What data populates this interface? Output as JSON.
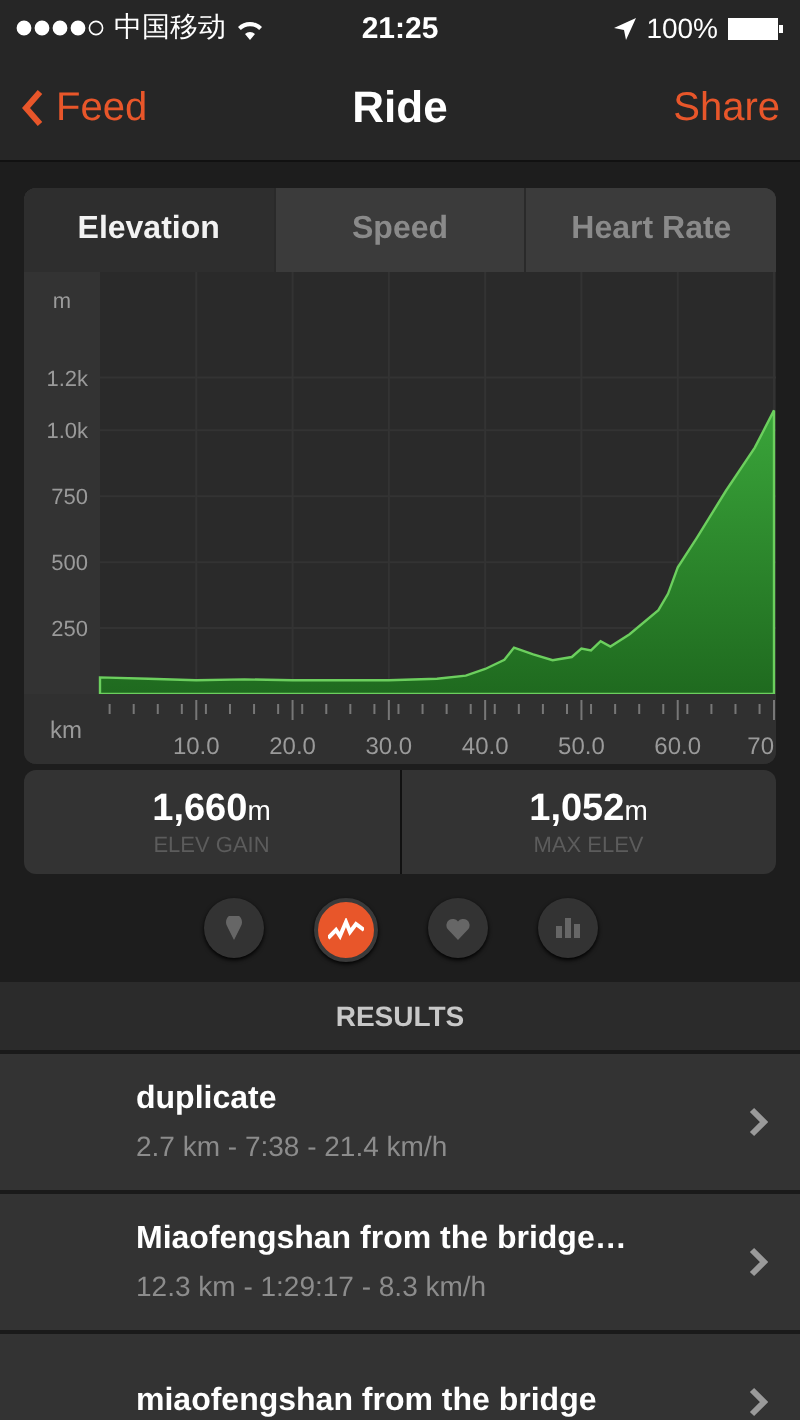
{
  "status_bar": {
    "carrier": "中国移动",
    "time": "21:25",
    "battery": "100%"
  },
  "nav": {
    "back": "Feed",
    "title": "Ride",
    "action": "Share"
  },
  "tabs": [
    {
      "label": "Elevation",
      "selected": true
    },
    {
      "label": "Speed",
      "selected": false
    },
    {
      "label": "Heart Rate",
      "selected": false
    }
  ],
  "chart_data": {
    "type": "area",
    "xlabel": "km",
    "ylabel": "m",
    "xlim": [
      0,
      70
    ],
    "ylim": [
      0,
      1600
    ],
    "grid": true,
    "xticks": [
      {
        "value": 10,
        "label": "10.0"
      },
      {
        "value": 20,
        "label": "20.0"
      },
      {
        "value": 30,
        "label": "30.0"
      },
      {
        "value": 40,
        "label": "40.0"
      },
      {
        "value": 50,
        "label": "50.0"
      },
      {
        "value": 60,
        "label": "60.0"
      },
      {
        "value": 70,
        "label": "70"
      }
    ],
    "yticks": [
      250,
      500,
      750,
      {
        "value": 1000,
        "label": "1.0k"
      },
      {
        "value": 1200,
        "label": "1.2k"
      }
    ],
    "x": [
      0,
      5,
      10,
      15,
      20,
      25,
      30,
      35,
      38,
      40,
      42,
      43,
      45,
      47,
      49,
      50,
      51,
      52,
      53,
      55,
      58,
      59,
      60,
      62,
      65,
      68,
      70
    ],
    "series": [
      {
        "color": "#6ccf5e",
        "values": [
          63,
          58,
          52,
          55,
          52,
          52,
          52,
          58,
          70,
          95,
          130,
          176,
          150,
          128,
          140,
          172,
          165,
          200,
          180,
          227,
          318,
          380,
          480,
          593,
          770,
          934,
          1075
        ]
      }
    ]
  },
  "stats": [
    {
      "value": "1,660",
      "unit": "m",
      "label": "ELEV GAIN"
    },
    {
      "value": "1,052",
      "unit": "m",
      "label": "MAX ELEV"
    }
  ],
  "view_buttons": [
    {
      "kind": "map",
      "selected": false
    },
    {
      "kind": "elevation",
      "selected": true
    },
    {
      "kind": "heart",
      "selected": false
    },
    {
      "kind": "stats",
      "selected": false
    }
  ],
  "results_header": "RESULTS",
  "results": [
    {
      "title": "duplicate",
      "detail": "2.7 km - 7:38 - 21.4 km/h"
    },
    {
      "title": "Miaofengshan from the bridge…",
      "detail": "12.3 km - 1:29:17 - 8.3 km/h"
    },
    {
      "title": "miaofengshan from the bridge"
    }
  ]
}
